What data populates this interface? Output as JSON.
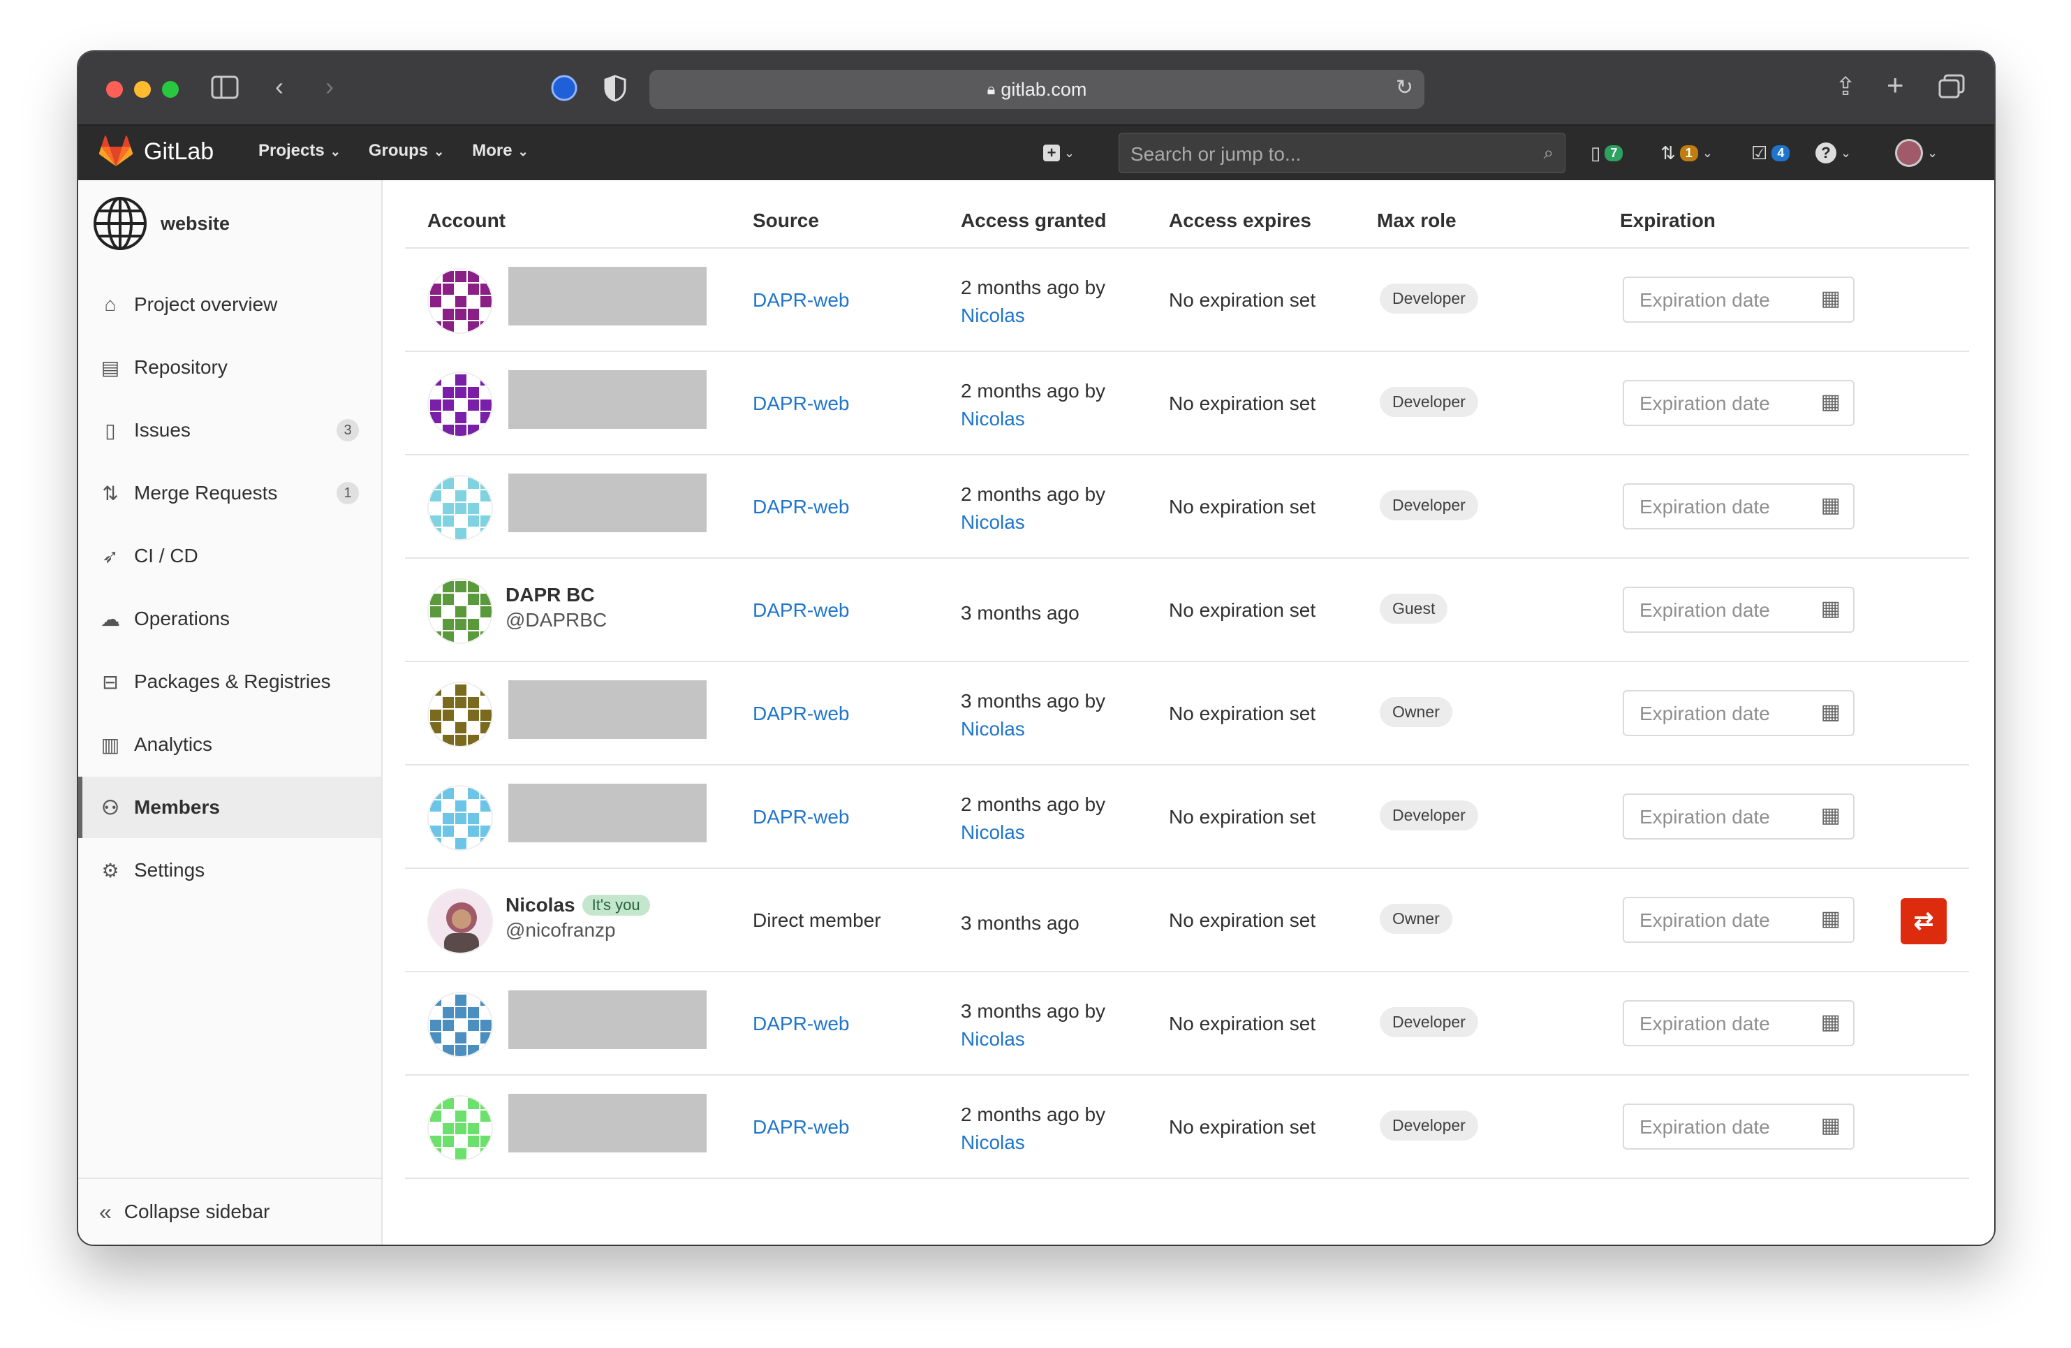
{
  "browser": {
    "url": "gitlab.com"
  },
  "header": {
    "logo_text": "GitLab",
    "nav": [
      "Projects",
      "Groups",
      "More"
    ],
    "search_placeholder": "Search or jump to...",
    "issues_count": "7",
    "mr_count": "1",
    "todo_count": "4"
  },
  "sidebar": {
    "project_name": "website",
    "items": [
      {
        "label": "Project overview",
        "icon": "home-icon"
      },
      {
        "label": "Repository",
        "icon": "doc-icon"
      },
      {
        "label": "Issues",
        "icon": "issues-icon",
        "count": "3"
      },
      {
        "label": "Merge Requests",
        "icon": "merge-request-icon",
        "count": "1"
      },
      {
        "label": "CI / CD",
        "icon": "rocket-icon"
      },
      {
        "label": "Operations",
        "icon": "cloud-icon"
      },
      {
        "label": "Packages & Registries",
        "icon": "package-icon"
      },
      {
        "label": "Analytics",
        "icon": "chart-icon"
      },
      {
        "label": "Members",
        "icon": "users-icon",
        "active": true
      },
      {
        "label": "Settings",
        "icon": "gear-icon"
      }
    ],
    "collapse_label": "Collapse sidebar"
  },
  "table": {
    "headers": {
      "account": "Account",
      "source": "Source",
      "granted": "Access granted",
      "expires": "Access expires",
      "max_role": "Max role",
      "expiration": "Expiration"
    },
    "expiration_placeholder": "Expiration date",
    "rows": [
      {
        "name": "",
        "username": "",
        "source": "DAPR-web",
        "granted": "2 months ago by",
        "granted_by": "Nicolas",
        "expires": "No expiration set",
        "role": "Developer",
        "avatar_color": "#8a1f86"
      },
      {
        "name": "",
        "username": "",
        "source": "DAPR-web",
        "granted": "2 months ago by",
        "granted_by": "Nicolas",
        "expires": "No expiration set",
        "role": "Developer",
        "avatar_color": "#7a1fa8"
      },
      {
        "name": "",
        "username": "",
        "source": "DAPR-web",
        "granted": "2 months ago by",
        "granted_by": "Nicolas",
        "expires": "No expiration set",
        "role": "Developer",
        "avatar_color": "#7fd3e0"
      },
      {
        "name": "DAPR BC",
        "username": "@DAPRBC",
        "source": "DAPR-web",
        "granted": "3 months ago",
        "granted_by": "",
        "expires": "No expiration set",
        "role": "Guest",
        "avatar_color": "#5b9a3c"
      },
      {
        "name": "",
        "username": "",
        "source": "DAPR-web",
        "granted": "3 months ago by",
        "granted_by": "Nicolas",
        "expires": "No expiration set",
        "role": "Owner",
        "avatar_color": "#7a6a1e"
      },
      {
        "name": "",
        "username": "",
        "source": "DAPR-web",
        "granted": "2 months ago by",
        "granted_by": "Nicolas",
        "expires": "No expiration set",
        "role": "Developer",
        "avatar_color": "#6cc5e6"
      },
      {
        "name": "Nicolas",
        "username": "@nicofranzp",
        "you_badge": "It's you",
        "source": "Direct member",
        "granted": "3 months ago",
        "granted_by": "",
        "expires": "No expiration set",
        "role": "Owner",
        "avatar_color": "#a05a6a"
      },
      {
        "name": "",
        "username": "",
        "source": "DAPR-web",
        "granted": "3 months ago by",
        "granted_by": "Nicolas",
        "expires": "No expiration set",
        "role": "Developer",
        "avatar_color": "#4a8fc0"
      },
      {
        "name": "",
        "username": "",
        "source": "DAPR-web",
        "granted": "2 months ago by",
        "granted_by": "Nicolas",
        "expires": "No expiration set",
        "role": "Developer",
        "avatar_color": "#6ce06c"
      }
    ]
  }
}
